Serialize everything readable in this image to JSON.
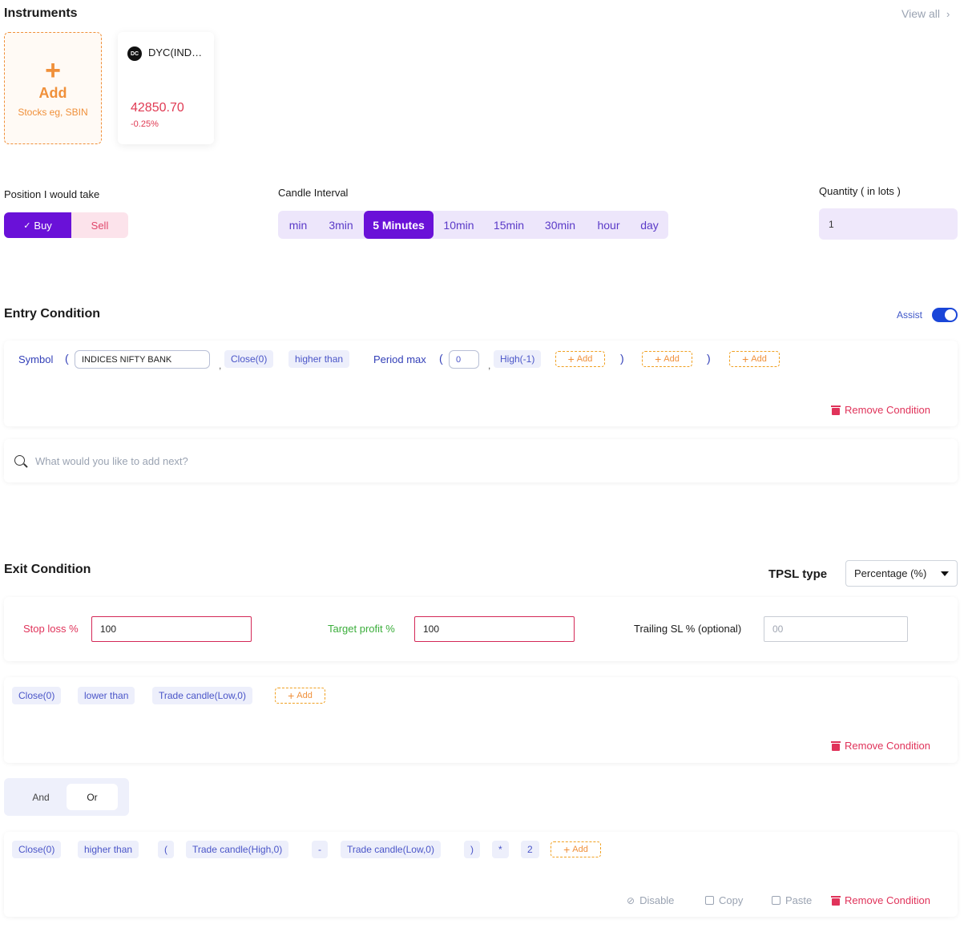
{
  "instruments": {
    "title": "Instruments",
    "view_all": "View all",
    "add_card": {
      "label": "Add",
      "hint": "Stocks eg, SBIN"
    },
    "cards": [
      {
        "logo": "DC",
        "name": "DYC(IND…",
        "price": "42850.70",
        "change": "-0.25%"
      }
    ]
  },
  "position": {
    "label": "Position I would take",
    "buy": "Buy",
    "sell": "Sell"
  },
  "candle": {
    "label": "Candle Interval",
    "options": [
      "min",
      "3min",
      "5 Minutes",
      "10min",
      "15min",
      "30min",
      "hour",
      "day"
    ],
    "selected": "5 Minutes"
  },
  "quantity": {
    "label": "Quantity ( in lots )",
    "value": "1"
  },
  "entry": {
    "title": "Entry Condition",
    "assist_label": "Assist",
    "tokens": {
      "symbol_kw": "Symbol",
      "open_paren": "(",
      "symbol_value": "INDICES NIFTY BANK",
      "comma": ",",
      "close0": "Close(0)",
      "higher_than": "higher than",
      "period_max": "Period max",
      "period_value": "0",
      "high_neg1": "High(-1)",
      "add": "Add",
      "close_paren": ")"
    },
    "remove": "Remove Condition",
    "search_placeholder": "What would you like to add next?"
  },
  "exit": {
    "title": "Exit Condition",
    "tpsl_label": "TPSL type",
    "tpsl_value": "Percentage (%)",
    "stop_loss_label": "Stop loss %",
    "stop_loss_value": "100",
    "target_label": "Target profit %",
    "target_value": "100",
    "trailing_label": "Trailing SL % (optional)",
    "trailing_placeholder": "00",
    "cond1": {
      "close0": "Close(0)",
      "lower_than": "lower than",
      "trade_low": "Trade candle(Low,0)",
      "add": "Add",
      "remove": "Remove Condition"
    },
    "logic": {
      "and": "And",
      "or": "Or"
    },
    "cond2": {
      "close0": "Close(0)",
      "higher_than": "higher than",
      "open_paren": "(",
      "trade_high": "Trade candle(High,0)",
      "minus": "-",
      "trade_low": "Trade candle(Low,0)",
      "close_paren": ")",
      "times": "*",
      "two": "2",
      "add": "Add",
      "disable": "Disable",
      "copy": "Copy",
      "paste": "Paste",
      "remove": "Remove Condition"
    }
  }
}
